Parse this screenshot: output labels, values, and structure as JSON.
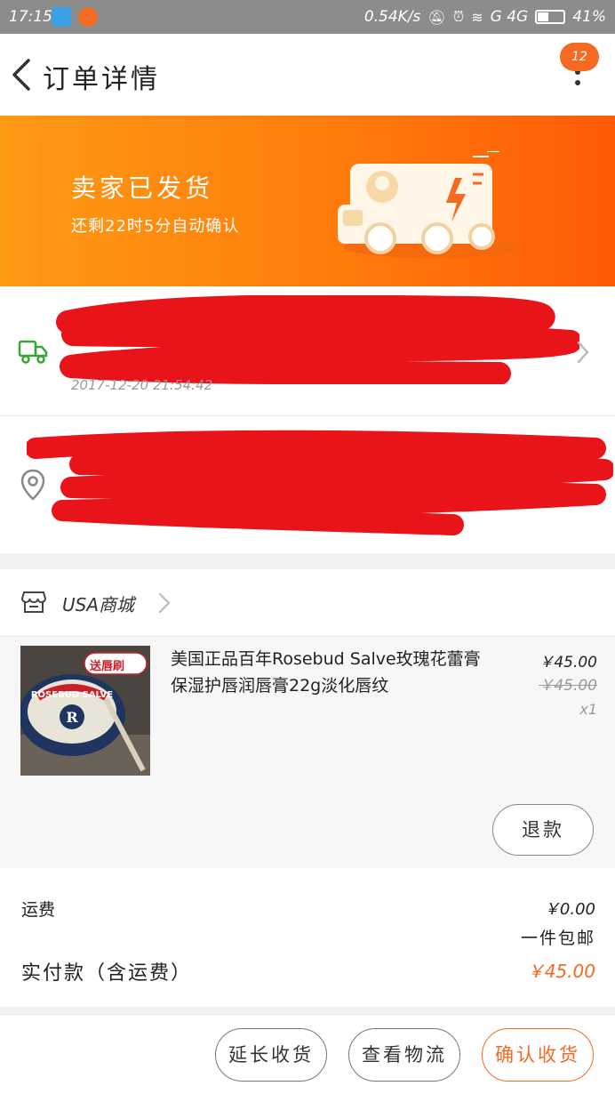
{
  "status_bar": {
    "time": "17:15",
    "network_speed": "0.54K/s",
    "signal_labels": "G 4G",
    "battery": "41%"
  },
  "header": {
    "title": "订单详情",
    "badge": "12"
  },
  "banner": {
    "status": "卖家已发货",
    "countdown": "还剩22时5分自动确认"
  },
  "logistics": {
    "time": "2017-12-20 21:54:42"
  },
  "shop": {
    "name": "USA商城"
  },
  "product": {
    "title": "美国正品百年Rosebud Salve玫瑰花蕾膏保湿护唇润唇膏22g淡化唇纹",
    "thumb_tag": "送唇刷",
    "price": "￥45.00",
    "original_price": "￥45.00",
    "quantity": "x1",
    "refund_label": "退款"
  },
  "summary": {
    "shipping_label": "运费",
    "shipping_value": "￥0.00",
    "free_shipping": "一件包邮",
    "paid_label": "实付款（含运费）",
    "paid_value": "￥45.00"
  },
  "actions": {
    "extend": "延长收货",
    "track": "查看物流",
    "confirm": "确认收货"
  },
  "colors": {
    "accent": "#f26b22",
    "banner_start": "#ff9a14",
    "banner_end": "#ff5a06",
    "logistics_green": "#3aa63a",
    "redaction": "#e8141a"
  }
}
